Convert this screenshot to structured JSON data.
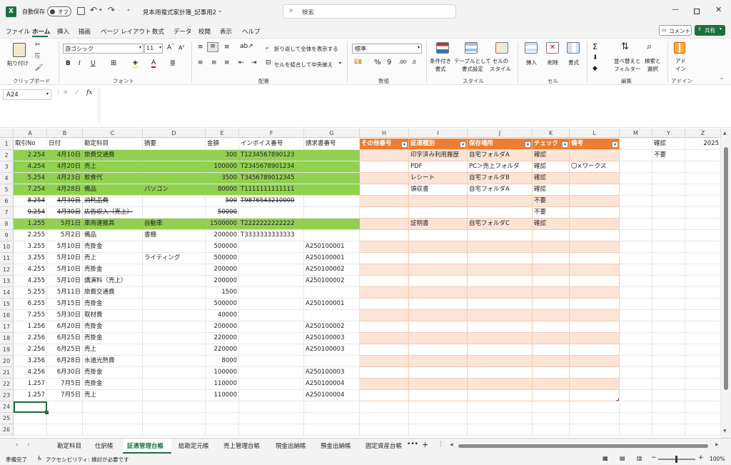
{
  "titlebar": {
    "autosave_label": "自動保存",
    "autosave_state": "オフ",
    "filename": "見本用複式家計簿_記事用2",
    "search_placeholder": "検索",
    "app_color": "#1d6f42"
  },
  "menu": {
    "tabs": [
      "ファイル",
      "ホーム",
      "挿入",
      "描画",
      "ページ レイアウト",
      "数式",
      "データ",
      "校閲",
      "表示",
      "ヘルプ"
    ],
    "active": "ホーム",
    "comment_label": "コメント",
    "share_label": "共有"
  },
  "ribbon": {
    "paste_label": "貼り付け",
    "clipboard_label": "クリップボード",
    "font_name": "游ゴシック",
    "font_size": "11",
    "font_label": "フォント",
    "wrap_label": "折り返して全体を表示する",
    "merge_label": "セルを結合して中央揃え",
    "align_label": "配置",
    "numfmt_value": "標準",
    "number_label": "数値",
    "cond_label": "条件付き\n書式",
    "table_label": "テーブルとして\n書式設定",
    "cellstyle_label": "セルの\nスタイル",
    "style_label": "スタイル",
    "insert_label": "挿入",
    "delete_label": "削除",
    "format_label": "書式",
    "cell_label": "セル",
    "sort_label": "並べ替えと\nフィルター",
    "find_label": "検索と\n選択",
    "edit_label": "編集",
    "addin_label": "アド\nイン",
    "addin_group_label": "アドイン"
  },
  "formula": {
    "namebox": "A24",
    "fx": "fx",
    "content": ""
  },
  "grid": {
    "columns": [
      "A",
      "B",
      "C",
      "D",
      "E",
      "F",
      "G",
      "H",
      "I",
      "J",
      "K",
      "L",
      "M",
      "Y",
      "Z"
    ],
    "headers": {
      "A": "取引No",
      "B": "日付",
      "C": "勘定科目",
      "D": "摘要",
      "E": "金額",
      "F": "インボイス番号",
      "G": "請求書番号",
      "H": "その他番号",
      "I": "証憑種別",
      "J": "保存場所",
      "K": "チェック",
      "L": "備考",
      "Y": "確認",
      "Z": "2025"
    },
    "rows": [
      {
        "A": "2.254",
        "B": "4月10日",
        "C": "旅費交通費",
        "D": "",
        "E": "300",
        "F": "T1234567890123",
        "G": "",
        "I": "印字済み利用履歴",
        "J": "自宅フォルダA",
        "K": "確認",
        "L": "",
        "Y": "不要",
        "fill": "green"
      },
      {
        "A": "4.254",
        "B": "4月20日",
        "C": "売上",
        "D": "",
        "E": "100000",
        "F": "T2345678901234",
        "G": "",
        "I": "PDF",
        "J": "PC＞売上フォルダ",
        "K": "確認",
        "L": "〇×ワークス",
        "Y": "",
        "fill": "green"
      },
      {
        "A": "5.254",
        "B": "4月23日",
        "C": "飲食代",
        "D": "",
        "E": "3500",
        "F": "T3456789012345",
        "G": "",
        "I": "レシート",
        "J": "自宅フォルダB",
        "K": "確認",
        "L": "",
        "Y": "",
        "fill": "green"
      },
      {
        "A": "7.254",
        "B": "4月28日",
        "C": "備品",
        "D": "パソコン",
        "E": "80000",
        "F": "T1111111111111",
        "G": "",
        "I": "領収書",
        "J": "自宅フォルダA",
        "K": "確認",
        "L": "",
        "Y": "",
        "fill": "green"
      },
      {
        "A": "8.254",
        "B": "4月30日",
        "C": "消耗品費",
        "D": "",
        "E": "500",
        "F": "T9876543210000",
        "G": "",
        "I": "",
        "J": "",
        "K": "不要",
        "L": "",
        "Y": "",
        "fill": "strike"
      },
      {
        "A": "9.254",
        "B": "4月30日",
        "C": "広告収入（売上）",
        "D": "",
        "E": "50000",
        "F": "",
        "G": "",
        "I": "",
        "J": "",
        "K": "不要",
        "L": "",
        "Y": "",
        "fill": "strike"
      },
      {
        "A": "1.255",
        "B": "5月1日",
        "C": "車両運搬具",
        "D": "自動車",
        "E": "1500000",
        "F": "T2222222222222",
        "G": "",
        "I": "証明書",
        "J": "自宅フォルダC",
        "K": "確認",
        "L": "",
        "Y": "",
        "fill": "green"
      },
      {
        "A": "2.255",
        "B": "5月2日",
        "C": "備品",
        "D": "書棚",
        "E": "200000",
        "F": "T3333333333333",
        "G": "",
        "I": "",
        "J": "",
        "K": "",
        "L": "",
        "Y": "",
        "fill": ""
      },
      {
        "A": "3.255",
        "B": "5月10日",
        "C": "売掛金",
        "D": "",
        "E": "500000",
        "F": "",
        "G": "A250100001",
        "I": "",
        "J": "",
        "K": "",
        "L": "",
        "Y": "",
        "fill": ""
      },
      {
        "A": "3.255",
        "B": "5月10日",
        "C": "売上",
        "D": "ライティング",
        "E": "500000",
        "F": "",
        "G": "A250100001",
        "I": "",
        "J": "",
        "K": "",
        "L": "",
        "Y": "",
        "fill": ""
      },
      {
        "A": "4.255",
        "B": "5月10日",
        "C": "売掛金",
        "D": "",
        "E": "200000",
        "F": "",
        "G": "A250100002",
        "I": "",
        "J": "",
        "K": "",
        "L": "",
        "Y": "",
        "fill": ""
      },
      {
        "A": "4.255",
        "B": "5月10日",
        "C": "講演料（売上）",
        "D": "",
        "E": "200000",
        "F": "",
        "G": "A250100002",
        "I": "",
        "J": "",
        "K": "",
        "L": "",
        "Y": "",
        "fill": ""
      },
      {
        "A": "5.255",
        "B": "5月11日",
        "C": "旅費交通費",
        "D": "",
        "E": "1500",
        "F": "",
        "G": "",
        "I": "",
        "J": "",
        "K": "",
        "L": "",
        "Y": "",
        "fill": ""
      },
      {
        "A": "6.255",
        "B": "5月15日",
        "C": "売掛金",
        "D": "",
        "E": "500000",
        "F": "",
        "G": "A250100001",
        "I": "",
        "J": "",
        "K": "",
        "L": "",
        "Y": "",
        "fill": ""
      },
      {
        "A": "7.255",
        "B": "5月30日",
        "C": "取材費",
        "D": "",
        "E": "40000",
        "F": "",
        "G": "",
        "I": "",
        "J": "",
        "K": "",
        "L": "",
        "Y": "",
        "fill": ""
      },
      {
        "A": "1.256",
        "B": "6月20日",
        "C": "売掛金",
        "D": "",
        "E": "200000",
        "F": "",
        "G": "A250100002",
        "I": "",
        "J": "",
        "K": "",
        "L": "",
        "Y": "",
        "fill": ""
      },
      {
        "A": "2.256",
        "B": "6月25日",
        "C": "売掛金",
        "D": "",
        "E": "220000",
        "F": "",
        "G": "A250100003",
        "I": "",
        "J": "",
        "K": "",
        "L": "",
        "Y": "",
        "fill": ""
      },
      {
        "A": "2.256",
        "B": "6月25日",
        "C": "売上",
        "D": "",
        "E": "220000",
        "F": "",
        "G": "A250100003",
        "I": "",
        "J": "",
        "K": "",
        "L": "",
        "Y": "",
        "fill": ""
      },
      {
        "A": "3.256",
        "B": "6月28日",
        "C": "水道光熱費",
        "D": "",
        "E": "8000",
        "F": "",
        "G": "",
        "I": "",
        "J": "",
        "K": "",
        "L": "",
        "Y": "",
        "fill": ""
      },
      {
        "A": "4.256",
        "B": "6月30日",
        "C": "売掛金",
        "D": "",
        "E": "100000",
        "F": "",
        "G": "A250100003",
        "I": "",
        "J": "",
        "K": "",
        "L": "",
        "Y": "",
        "fill": ""
      },
      {
        "A": "1.257",
        "B": "7月5日",
        "C": "売掛金",
        "D": "",
        "E": "110000",
        "F": "",
        "G": "A250100004",
        "I": "",
        "J": "",
        "K": "",
        "L": "",
        "Y": "",
        "fill": ""
      },
      {
        "A": "1.257",
        "B": "7月5日",
        "C": "売上",
        "D": "",
        "E": "110000",
        "F": "",
        "G": "A250100004",
        "I": "",
        "J": "",
        "K": "",
        "L": "",
        "Y": "",
        "fill": ""
      }
    ],
    "row_numbers": [
      "1",
      "2",
      "3",
      "4",
      "5",
      "6",
      "7",
      "8",
      "9",
      "10",
      "11",
      "12",
      "13",
      "14",
      "15",
      "16",
      "17",
      "18",
      "19",
      "20",
      "21",
      "22",
      "23",
      "24",
      "25",
      "26"
    ],
    "colors": {
      "green": "#92d050",
      "orange_header": "#ed7d31",
      "band_light": "#fce4d6",
      "band_white": "#ffffff"
    }
  },
  "sheets": {
    "tabs": [
      "勘定科目",
      "仕訳帳",
      "証憑管理台帳",
      "総勘定元帳",
      "売上管理台帳",
      "現金出納帳",
      "預金出納帳",
      "固定資産台帳"
    ],
    "active": "証憑管理台帳"
  },
  "status": {
    "ready": "準備完了",
    "accessibility": "アクセシビリティ: 検討が必要です",
    "zoom": "100%"
  }
}
